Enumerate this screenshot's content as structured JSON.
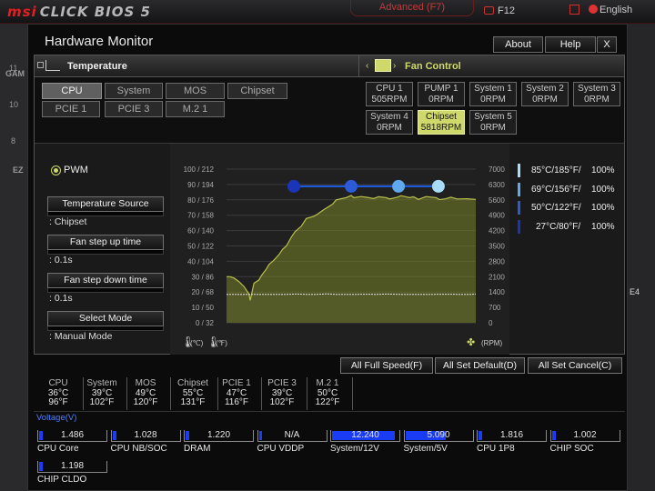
{
  "bios": {
    "brand": "msi",
    "product": "CLICK BIOS 5",
    "advanced_label": "Advanced (F7)",
    "f12_label": "F12",
    "language_label": "English",
    "side_numbers": [
      "11",
      "10",
      "8"
    ],
    "side_labels": [
      "GAM",
      "EZ"
    ],
    "right_label": "E4"
  },
  "window": {
    "title": "Hardware Monitor",
    "about_label": "About",
    "help_label": "Help",
    "close_label": "X"
  },
  "temperature": {
    "header": "Temperature",
    "tabs": [
      "CPU",
      "System",
      "MOS",
      "Chipset",
      "PCIE 1",
      "PCIE 3",
      "M.2 1"
    ],
    "selected": "CPU"
  },
  "fan_control": {
    "header": "Fan Control",
    "fans": [
      {
        "name": "CPU 1",
        "rpm": "505RPM"
      },
      {
        "name": "PUMP 1",
        "rpm": "0RPM"
      },
      {
        "name": "System 1",
        "rpm": "0RPM"
      },
      {
        "name": "System 2",
        "rpm": "0RPM"
      },
      {
        "name": "System 3",
        "rpm": "0RPM"
      },
      {
        "name": "System 4",
        "rpm": "0RPM"
      },
      {
        "name": "Chipset",
        "rpm": "5818RPM"
      },
      {
        "name": "System 5",
        "rpm": "0RPM"
      }
    ],
    "selected": "Chipset"
  },
  "settings": {
    "mode": "PWM",
    "temp_source_label": "Temperature Source",
    "temp_source_value": ": Chipset",
    "step_up_label": "Fan step up time",
    "step_up_value": ": 0.1s",
    "step_down_label": "Fan step down time",
    "step_down_value": ": 0.1s",
    "select_mode_label": "Select Mode",
    "select_mode_value": ": Manual Mode"
  },
  "graph": {
    "left_ticks": [
      "100 / 212",
      "90 / 194",
      "80 / 176",
      "70 / 158",
      "60 / 140",
      "50 / 122",
      "40 / 104",
      "30 /  86",
      "20 /  68",
      "10 /  50",
      "0 /  32"
    ],
    "right_ticks": [
      "7000",
      "6300",
      "5600",
      "4900",
      "4200",
      "3500",
      "2800",
      "2100",
      "1400",
      "700",
      "0"
    ],
    "celsius_label": "(℃)",
    "fahrenheit_label": "(℉)",
    "rpm_label": "(RPM)",
    "rpm_curve": [
      [
        0,
        0
      ],
      [
        3,
        0
      ],
      [
        6,
        80
      ],
      [
        10,
        280
      ],
      [
        14,
        560
      ],
      [
        18,
        980
      ],
      [
        19,
        1350
      ],
      [
        22,
        1800
      ],
      [
        26,
        1950
      ],
      [
        28,
        2150
      ],
      [
        32,
        2450
      ],
      [
        34,
        2650
      ],
      [
        38,
        2850
      ],
      [
        42,
        3100
      ],
      [
        45,
        3350
      ],
      [
        48,
        3500
      ],
      [
        52,
        3900
      ],
      [
        55,
        4150
      ],
      [
        60,
        4400
      ],
      [
        64,
        4750
      ],
      [
        70,
        4850
      ],
      [
        73,
        4950
      ],
      [
        78,
        5150
      ],
      [
        85,
        5400
      ],
      [
        88,
        5600
      ],
      [
        96,
        5700
      ],
      [
        100,
        5800
      ],
      [
        102,
        5700
      ],
      [
        108,
        5750
      ],
      [
        112,
        5720
      ],
      [
        118,
        5660
      ],
      [
        122,
        5740
      ],
      [
        128,
        5700
      ],
      [
        131,
        5640
      ],
      [
        137,
        5720
      ],
      [
        140,
        5790
      ],
      [
        147,
        5700
      ],
      [
        150,
        5740
      ],
      [
        154,
        5620
      ],
      [
        160,
        5750
      ],
      [
        168,
        5700
      ],
      [
        171,
        5610
      ],
      [
        176,
        5650
      ],
      [
        180,
        5720
      ],
      [
        185,
        5640
      ],
      [
        193,
        5650
      ],
      [
        200,
        5620
      ]
    ],
    "temp_line": [
      [
        0,
        18.5
      ],
      [
        10,
        18.5
      ],
      [
        12,
        18.5
      ],
      [
        14,
        18.7
      ],
      [
        16,
        18.5
      ],
      [
        18,
        18.5
      ],
      [
        20,
        18.8
      ],
      [
        22,
        18.5
      ],
      [
        26,
        18.5
      ],
      [
        28,
        18.6
      ],
      [
        30,
        18.5
      ],
      [
        32,
        18.7
      ],
      [
        35,
        18.5
      ],
      [
        38,
        18.5
      ],
      [
        40,
        18.5
      ],
      [
        41,
        18.5
      ],
      [
        44,
        18.6
      ],
      [
        47,
        18.5
      ],
      [
        49,
        18.5
      ],
      [
        50,
        18.7
      ]
    ],
    "temp_line_span": 50,
    "control_points_temp": [
      27,
      50,
      69,
      85
    ],
    "control_points_pct": [
      100,
      100,
      100,
      100
    ],
    "legend": [
      {
        "label": "85°C/185°F/",
        "pct": "100%",
        "color": "#a9dcf7"
      },
      {
        "label": "69°C/156°F/",
        "pct": "100%",
        "color": "#5fa8ee"
      },
      {
        "label": "50°C/122°F/",
        "pct": "100%",
        "color": "#2c5ad9"
      },
      {
        "label": "27°C/80°F/",
        "pct": "100%",
        "color": "#1a35b8"
      }
    ]
  },
  "buttons": {
    "full_speed": "All Full Speed(F)",
    "set_default": "All Set Default(D)",
    "set_cancel": "All Set Cancel(C)"
  },
  "temps_row": [
    {
      "name": "CPU",
      "c": "36°C",
      "f": "96°F"
    },
    {
      "name": "System",
      "c": "39°C",
      "f": "102°F"
    },
    {
      "name": "MOS",
      "c": "49°C",
      "f": "120°F"
    },
    {
      "name": "Chipset",
      "c": "55°C",
      "f": "131°F"
    },
    {
      "name": "PCIE 1",
      "c": "47°C",
      "f": "116°F"
    },
    {
      "name": "PCIE 3",
      "c": "39°C",
      "f": "102°F"
    },
    {
      "name": "M.2 1",
      "c": "50°C",
      "f": "122°F"
    }
  ],
  "voltage": {
    "label": "Voltage(V)",
    "items": [
      {
        "name": "CPU Core",
        "value": "1.486",
        "fill": 0.06
      },
      {
        "name": "CPU NB/SOC",
        "value": "1.028",
        "fill": 0.05
      },
      {
        "name": "DRAM",
        "value": "1.220",
        "fill": 0.05
      },
      {
        "name": "CPU VDDP",
        "value": "N/A",
        "fill": 0
      },
      {
        "name": "System/12V",
        "value": "12.240",
        "fill": 0.95
      },
      {
        "name": "System/5V",
        "value": "5.090",
        "fill": 0.6
      },
      {
        "name": "CPU 1P8",
        "value": "1.816",
        "fill": 0.06
      },
      {
        "name": "CHIP SOC",
        "value": "1.002",
        "fill": 0.05
      },
      {
        "name": "CHIP CLDO",
        "value": "1.198",
        "fill": 0.05
      }
    ]
  },
  "colors": {
    "accent_fan": "#cfd86a",
    "volt_bar": "#1a3cf5",
    "brand_red": "#e02020"
  }
}
